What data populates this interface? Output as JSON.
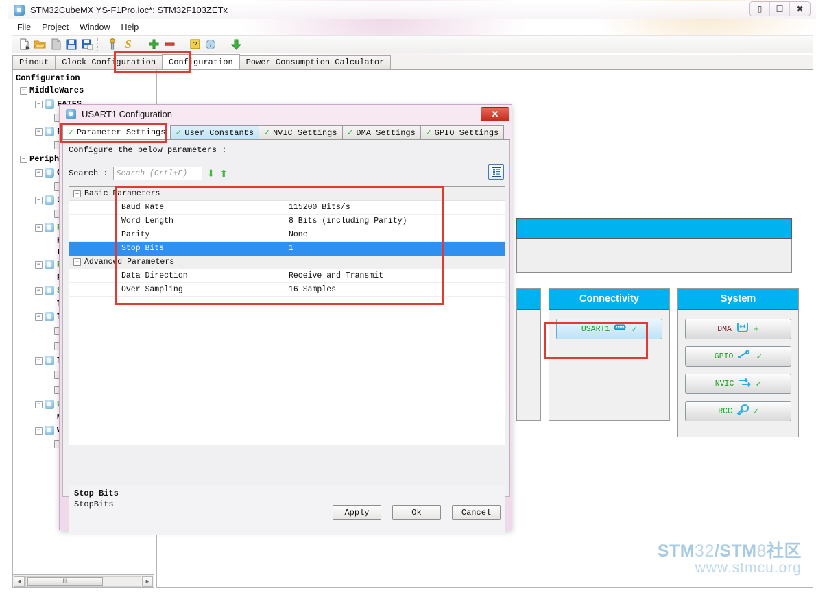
{
  "window": {
    "title": "STM32CubeMX YS-F1Pro.ioc*: STM32F103ZETx",
    "app_icon": "cube-icon",
    "buttons": {
      "minimize": "minimize-icon",
      "maximize": "maximize-icon",
      "close": "close-icon"
    }
  },
  "menubar": {
    "items": [
      {
        "label": "File"
      },
      {
        "label": "Project"
      },
      {
        "label": "Window"
      },
      {
        "label": "Help"
      }
    ]
  },
  "toolbar": {
    "items": [
      {
        "name": "new-project-icon",
        "glyph": "📄"
      },
      {
        "name": "open-project-icon",
        "glyph": "📂"
      },
      {
        "name": "close-project-icon",
        "glyph": "📃"
      },
      {
        "name": "save-icon",
        "glyph": "💾"
      },
      {
        "name": "save-as-icon",
        "glyph": "🖫"
      },
      {
        "name": "generate-code-icon",
        "glyph": "🔧"
      },
      {
        "name": "report-icon",
        "glyph": "S"
      },
      {
        "name": "zoom-in-icon",
        "glyph": "+"
      },
      {
        "name": "zoom-out-icon",
        "glyph": "−"
      },
      {
        "name": "help-icon",
        "glyph": "?"
      },
      {
        "name": "about-icon",
        "glyph": "i"
      },
      {
        "name": "download-icon",
        "glyph": "↓"
      }
    ]
  },
  "tabs": {
    "items": [
      {
        "label": "Pinout",
        "active": false
      },
      {
        "label": "Clock Configuration",
        "active": false
      },
      {
        "label": "Configuration",
        "active": true
      },
      {
        "label": "Power Consumption Calculator",
        "active": false
      }
    ]
  },
  "sidebar": {
    "root_label": "Configuration",
    "groups": [
      {
        "label": "MiddleWares",
        "items": [
          {
            "label": "FATFS",
            "green": false,
            "children": [
              "checkbox"
            ]
          },
          {
            "label": "FR",
            "green": false,
            "children": [
              "checkbox"
            ]
          }
        ]
      },
      {
        "label": "Peripher",
        "items": [
          {
            "label": "CR",
            "green": false,
            "children": [
              "checkbox"
            ]
          },
          {
            "label": "IW",
            "green": false,
            "children": [
              "checkbox"
            ]
          },
          {
            "label": "RC",
            "green": true,
            "children": [
              "Hi",
              "Lo"
            ]
          },
          {
            "label": "RT",
            "green": true,
            "children": [
              "RT"
            ]
          },
          {
            "label": "SY",
            "green": true,
            "children": [
              "Ti"
            ]
          },
          {
            "label": "TI",
            "green": false,
            "children": [
              "checkbox",
              "checkbox"
            ]
          },
          {
            "label": "TI",
            "green": false,
            "children": [
              "checkbox",
              "checkbox"
            ]
          },
          {
            "label": "US",
            "green": true,
            "children": [
              "Mo"
            ]
          },
          {
            "label": "WW",
            "green": false,
            "children": [
              "checkbox"
            ]
          }
        ]
      }
    ],
    "hscrollbar": {
      "left_arrow": "◄",
      "right_arrow": "►",
      "grip": "‖‖"
    }
  },
  "peripheral_panels": {
    "columns": [
      {
        "title": "",
        "clipped": true,
        "buttons": []
      },
      {
        "title": "Connectivity",
        "clipped": false,
        "buttons": [
          {
            "label": "USART1",
            "icon": "serial-port-icon",
            "selected": true,
            "checked": true
          }
        ]
      },
      {
        "title": "System",
        "clipped": false,
        "buttons": [
          {
            "label": "DMA",
            "icon": "dma-icon",
            "selected": false,
            "checked": true
          },
          {
            "label": "GPIO",
            "icon": "gpio-icon",
            "selected": false,
            "checked": true
          },
          {
            "label": "NVIC",
            "icon": "nvic-icon",
            "selected": false,
            "checked": true
          },
          {
            "label": "RCC",
            "icon": "wrench-icon",
            "selected": false,
            "checked": true
          }
        ]
      }
    ]
  },
  "dialog": {
    "title": "USART1 Configuration",
    "icon": "cube-icon",
    "close_label": "✕",
    "tabs": [
      {
        "label": "Parameter Settings",
        "state": "active"
      },
      {
        "label": "User Constants",
        "state": "hover"
      },
      {
        "label": "NVIC Settings",
        "state": "normal"
      },
      {
        "label": "DMA Settings",
        "state": "normal"
      },
      {
        "label": "GPIO Settings",
        "state": "normal"
      }
    ],
    "instruction": "Configure the below parameters :",
    "search": {
      "label": "Search :",
      "placeholder": "Search (Crtl+F)",
      "value": "",
      "next_icon": "arrow-down-icon",
      "prev_icon": "arrow-up-icon",
      "view_icon": "list-view-icon"
    },
    "parameters": [
      {
        "type": "group",
        "name": "Basic Parameters",
        "expanded": true
      },
      {
        "type": "row",
        "key": "Baud Rate",
        "value": "115200 Bits/s",
        "selected": false
      },
      {
        "type": "row",
        "key": "Word Length",
        "value": "8 Bits (including Parity)",
        "selected": false
      },
      {
        "type": "row",
        "key": "Parity",
        "value": "None",
        "selected": false
      },
      {
        "type": "row",
        "key": "Stop Bits",
        "value": "1",
        "selected": true
      },
      {
        "type": "group",
        "name": "Advanced Parameters",
        "expanded": true
      },
      {
        "type": "row",
        "key": "Data Direction",
        "value": "Receive and Transmit",
        "selected": false
      },
      {
        "type": "row",
        "key": "Over Sampling",
        "value": "16 Samples",
        "selected": false
      }
    ],
    "description": {
      "title": "Stop Bits",
      "body": "StopBits"
    },
    "footer_buttons": [
      {
        "label": "Apply"
      },
      {
        "label": "Ok"
      },
      {
        "label": "Cancel"
      }
    ]
  },
  "watermark": {
    "line1_bold1": "STM",
    "line1_light1": "32",
    "line1_bold2": "/STM",
    "line1_light2": "8",
    "line1_cjk": "社区",
    "line2": "www.stmcu.org"
  },
  "annotations": {
    "color": "#e03a32",
    "boxes": [
      {
        "name": "configuration-tab-highlight"
      },
      {
        "name": "parameter-settings-tab-highlight"
      },
      {
        "name": "parameters-table-highlight"
      },
      {
        "name": "usart1-button-highlight"
      }
    ]
  }
}
